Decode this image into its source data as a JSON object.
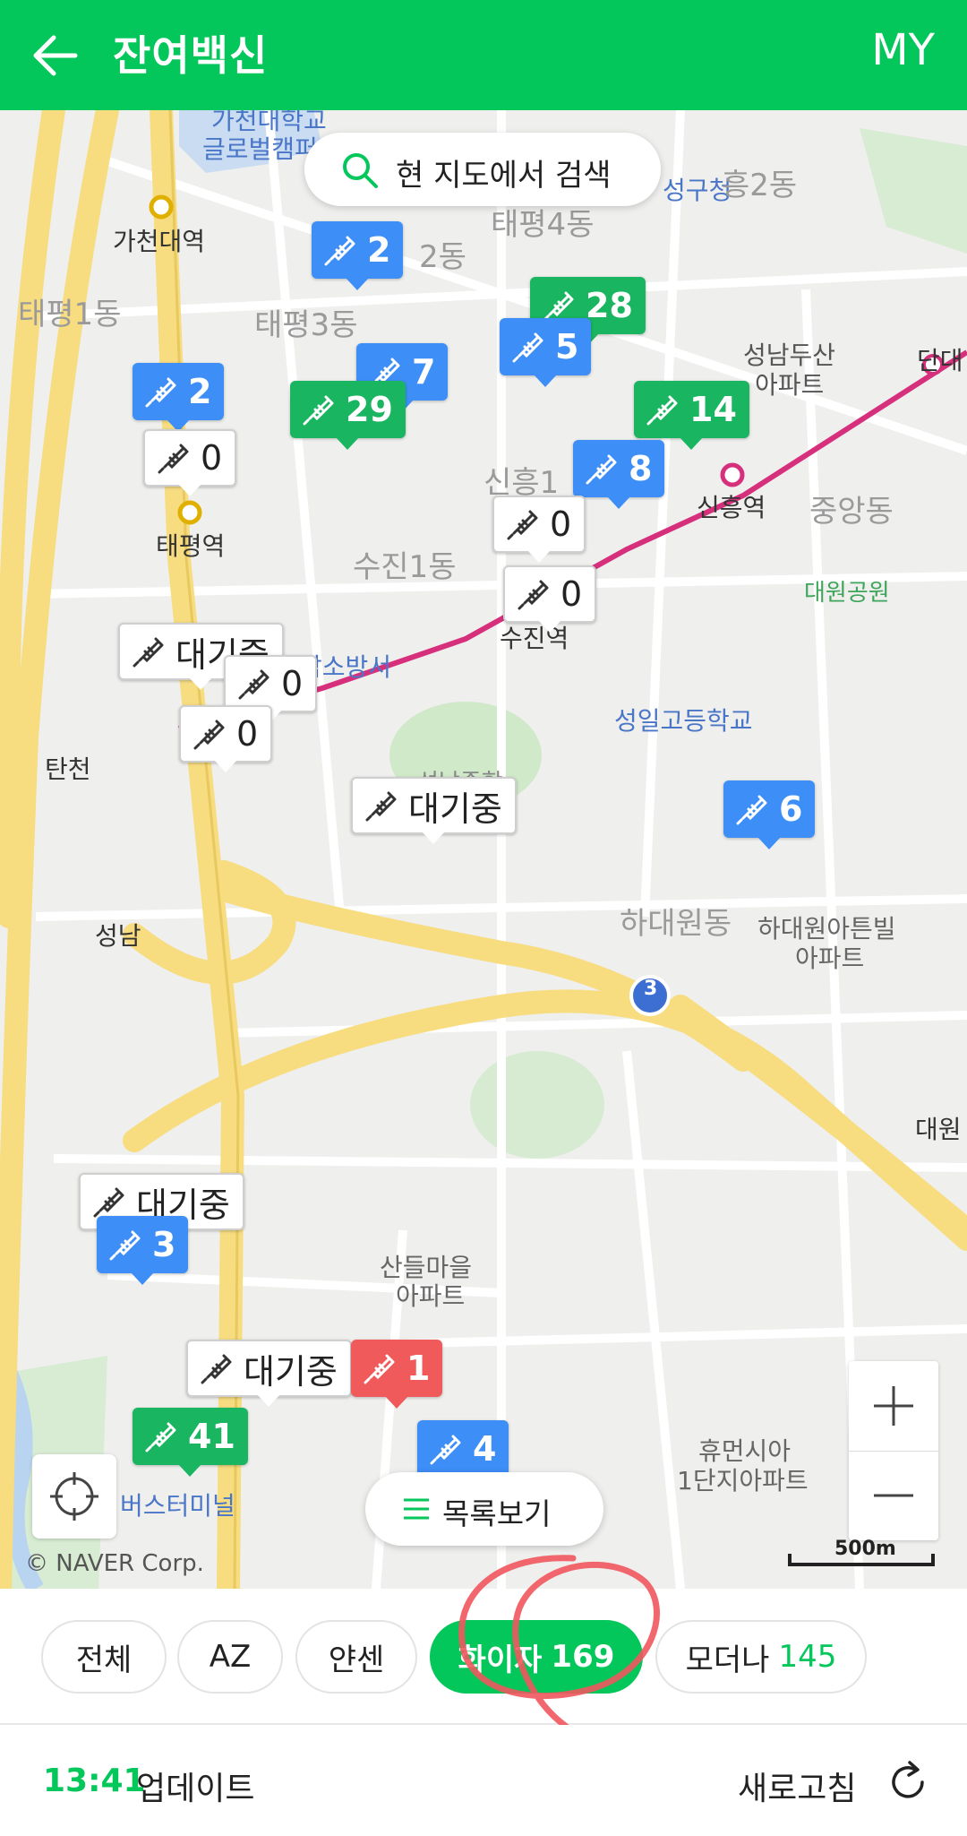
{
  "header": {
    "title": "잔여백신",
    "my": "MY"
  },
  "map": {
    "search_button": "현 지도에서 검색",
    "list_button": "목록보기",
    "copyright": "© NAVER Corp.",
    "scale_label": "500m",
    "labels": {
      "gachon_univ": "가천대학교",
      "global_campus": "글로벌캠퍼스",
      "gachon_station": "가천대역",
      "taepyeong1": "태평1동",
      "taepyeong3": "태평3동",
      "taepyeong4": "태평4동",
      "ward2": "2동",
      "gu_office": "성구청",
      "heung2": "흥2동",
      "seongnam_dusan": "성남두산",
      "apt1": "아파트",
      "dandae": "단대",
      "taepyeong_station": "태평역",
      "sinheung1": "신흥1",
      "sinheung_station": "신흥역",
      "jungang": "중앙동",
      "daewon_park": "대원공원",
      "sujin1": "수진1동",
      "sujin_station": "수진역",
      "fire_station": "남소방서",
      "seongil_school": "성일고등학교",
      "ic_tancheon": "탄천",
      "ic_seongnam": "성남",
      "hadaewon": "하대원동",
      "hadaewon_apt": "하대원아튼빌",
      "apt2": "아파트",
      "route3": "3",
      "ic_daewon": "대원",
      "sandeul": "산들마을",
      "apt3": "아파트",
      "humansia": "휴먼시아",
      "danji1": "1단지아파트",
      "bus_terminal": "버스터미널",
      "sports": "성남종합"
    },
    "markers": [
      {
        "color": "blue",
        "count": "2"
      },
      {
        "color": "green",
        "count": "28"
      },
      {
        "color": "blue",
        "count": "7"
      },
      {
        "color": "blue",
        "count": "5"
      },
      {
        "color": "blue",
        "count": "2"
      },
      {
        "color": "green",
        "count": "29"
      },
      {
        "color": "green",
        "count": "14"
      },
      {
        "color": "blue",
        "count": "8"
      },
      {
        "color": "white",
        "count": "0"
      },
      {
        "color": "white",
        "count": "0"
      },
      {
        "color": "white",
        "count": "0"
      },
      {
        "color": "white",
        "count": "대기중"
      },
      {
        "color": "white",
        "count": "0"
      },
      {
        "color": "white",
        "count": "0"
      },
      {
        "color": "white",
        "count": "대기중"
      },
      {
        "color": "blue",
        "count": "6"
      },
      {
        "color": "white",
        "count": "대기중"
      },
      {
        "color": "white",
        "count": "대기중"
      },
      {
        "color": "red",
        "count": "1"
      },
      {
        "color": "green",
        "count": "41"
      },
      {
        "color": "blue",
        "count": "4"
      },
      {
        "color": "blue",
        "count": "3"
      }
    ]
  },
  "filters": [
    {
      "label": "전체",
      "count": ""
    },
    {
      "label": "AZ",
      "count": ""
    },
    {
      "label": "얀센",
      "count": ""
    },
    {
      "label": "화이자",
      "count": "169"
    },
    {
      "label": "모더나",
      "count": "145"
    }
  ],
  "footer": {
    "time": "13:41",
    "updated_label": "업데이트",
    "refresh_label": "새로고침"
  },
  "colors": {
    "brand": "#03C75A",
    "marker_blue": "#3E8EF7",
    "marker_red": "#F05A5A",
    "annotation": "#F0575D"
  }
}
